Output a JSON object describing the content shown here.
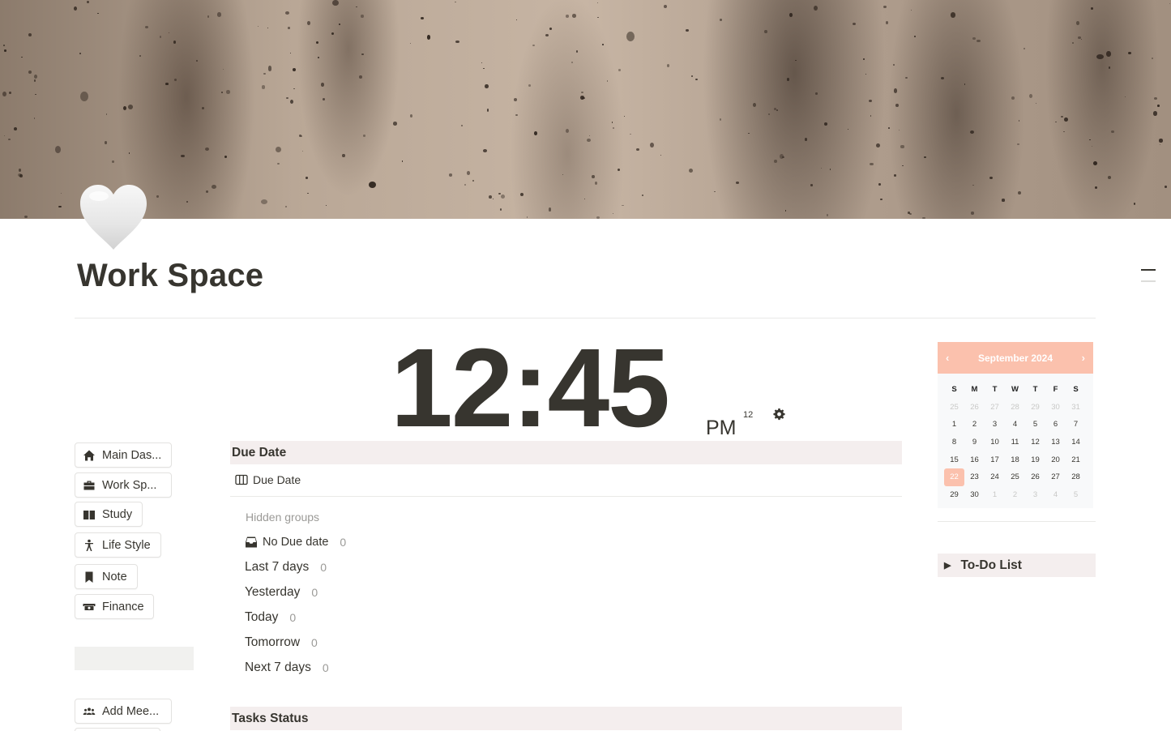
{
  "page": {
    "title": "Work Space",
    "icon": "white-heart-icon"
  },
  "nav_buttons": [
    {
      "label": "Main Das...",
      "icon": "home-icon"
    },
    {
      "label": "Work Sp...",
      "icon": "briefcase-icon"
    },
    {
      "label": "Study",
      "icon": "book-icon"
    },
    {
      "label": "Life Style",
      "icon": "person-icon"
    },
    {
      "label": "Note",
      "icon": "bookmark-icon"
    },
    {
      "label": "Finance",
      "icon": "money-icon"
    },
    {
      "label": "Add Mee...",
      "icon": "people-icon"
    }
  ],
  "clock": {
    "time": "12:45",
    "ampm": "PM",
    "format": "12",
    "settings_icon": "gear-icon"
  },
  "due_date": {
    "header": "Due Date",
    "view_label": "Due Date",
    "view_icon": "board-icon",
    "hidden_groups_label": "Hidden groups",
    "hidden_groups": [
      {
        "label": "No Due date",
        "count": "0",
        "icon": "inbox-icon"
      }
    ],
    "groups": [
      {
        "label": "Last 7 days",
        "count": "0"
      },
      {
        "label": "Yesterday",
        "count": "0"
      },
      {
        "label": "Today",
        "count": "0"
      },
      {
        "label": "Tomorrow",
        "count": "0"
      },
      {
        "label": "Next 7 days",
        "count": "0"
      }
    ]
  },
  "tasks_status": {
    "header": "Tasks Status"
  },
  "calendar": {
    "month_label": "September 2024",
    "prev": "‹",
    "next": "›",
    "weekdays": [
      "S",
      "M",
      "T",
      "W",
      "T",
      "F",
      "S"
    ],
    "weeks": [
      [
        {
          "d": "25",
          "m": true
        },
        {
          "d": "26",
          "m": true
        },
        {
          "d": "27",
          "m": true
        },
        {
          "d": "28",
          "m": true
        },
        {
          "d": "29",
          "m": true
        },
        {
          "d": "30",
          "m": true
        },
        {
          "d": "31",
          "m": true
        }
      ],
      [
        {
          "d": "1"
        },
        {
          "d": "2"
        },
        {
          "d": "3"
        },
        {
          "d": "4"
        },
        {
          "d": "5"
        },
        {
          "d": "6"
        },
        {
          "d": "7"
        }
      ],
      [
        {
          "d": "8"
        },
        {
          "d": "9"
        },
        {
          "d": "10"
        },
        {
          "d": "11"
        },
        {
          "d": "12"
        },
        {
          "d": "13"
        },
        {
          "d": "14"
        }
      ],
      [
        {
          "d": "15"
        },
        {
          "d": "16"
        },
        {
          "d": "17"
        },
        {
          "d": "18"
        },
        {
          "d": "19"
        },
        {
          "d": "20"
        },
        {
          "d": "21"
        }
      ],
      [
        {
          "d": "22",
          "today": true
        },
        {
          "d": "23"
        },
        {
          "d": "24"
        },
        {
          "d": "25"
        },
        {
          "d": "26"
        },
        {
          "d": "27"
        },
        {
          "d": "28"
        }
      ],
      [
        {
          "d": "29"
        },
        {
          "d": "30"
        },
        {
          "d": "1",
          "m": true
        },
        {
          "d": "2",
          "m": true
        },
        {
          "d": "3",
          "m": true
        },
        {
          "d": "4",
          "m": true
        },
        {
          "d": "5",
          "m": true
        }
      ]
    ],
    "accent_color": "#fbc1ad"
  },
  "todo": {
    "label": "To-Do List",
    "toggle_icon": "▶"
  }
}
